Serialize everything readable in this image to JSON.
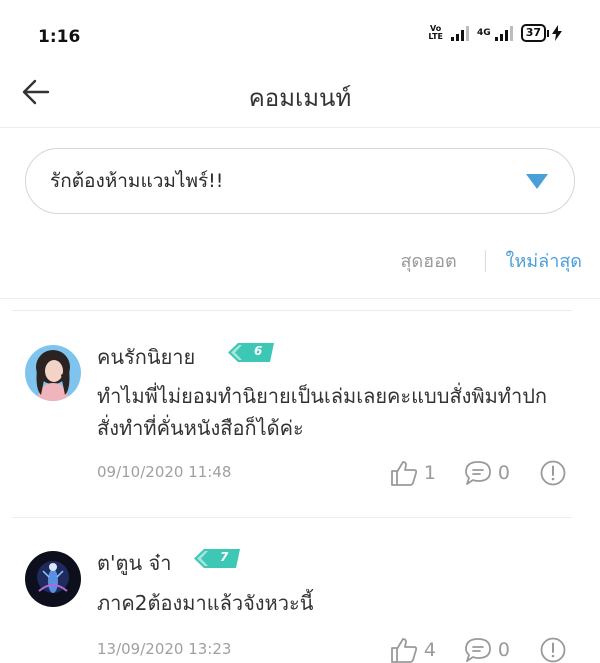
{
  "status_bar": {
    "time": "1:16",
    "volte_top": "Vo",
    "volte_bottom": "LTE",
    "network": "4G",
    "battery": "37"
  },
  "header": {
    "title": "คอมเมนท์"
  },
  "selector": {
    "label": "รักต้องห้ามแวมไพร์!!"
  },
  "sort": {
    "hot_label": "สุดฮอต",
    "new_label": "ใหม่ล่าสุด"
  },
  "comments": [
    {
      "username": "คนรักนิยาย",
      "level": "6",
      "text": "ทำไมพี่ไม่ยอมทำนิยายเป็นเล่มเลยคะแบบสั่งพิมทำปก สั่งทำที่คั่นหนังสือก็ได้ค่ะ",
      "date": "09/10/2020 11:48",
      "likes": "1",
      "replies": "0"
    },
    {
      "username": "ต'ตูน จ๋า",
      "level": "7",
      "text": "ภาค2ต้องมาแล้วจังหวะนี้",
      "date": "13/09/2020 13:23",
      "likes": "4",
      "replies": "0"
    }
  ],
  "colors": {
    "accent": "#4a9fd8",
    "badge": "#3cc8b4"
  },
  "icons": [
    "back-arrow-icon",
    "dropdown-triangle-icon",
    "thumbs-up-icon",
    "chat-bubble-icon",
    "report-icon"
  ]
}
